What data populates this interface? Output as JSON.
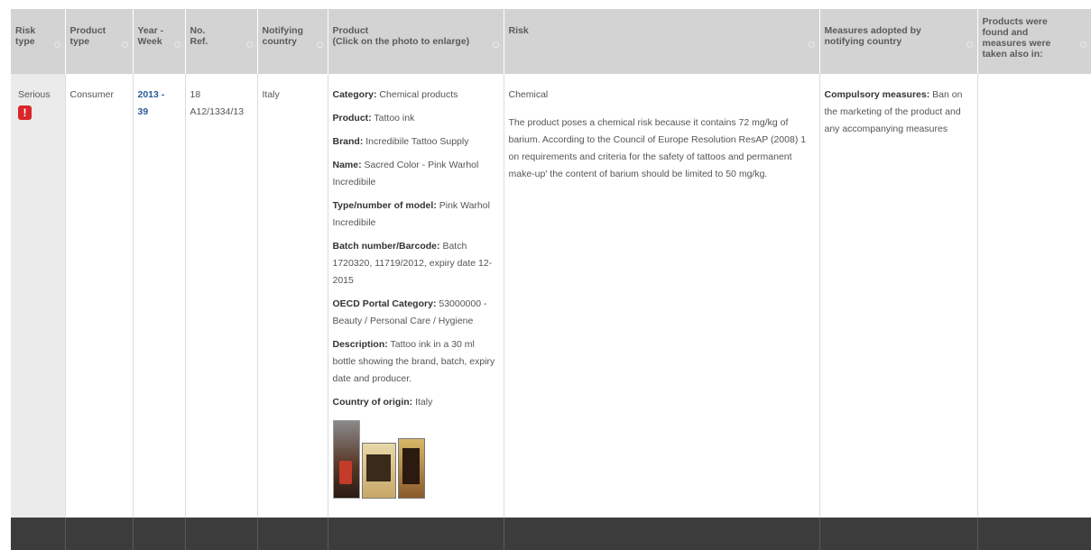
{
  "headers": [
    "Risk\ntype",
    "Product\ntype",
    "Year -\nWeek",
    "No.\nRef.",
    "Notifying\ncountry",
    "Product\n(Click on the photo to enlarge)",
    "Risk",
    "Measures adopted by\nnotifying country",
    "Products were\nfound and\nmeasures were\ntaken also in:"
  ],
  "row": {
    "risk_type": "Serious",
    "risk_icon": "!",
    "product_type": "Consumer",
    "year_week": "2013 -\n39",
    "ref": "18\nA12/1334/13",
    "country": "Italy",
    "product": {
      "category_label": "Category:",
      "category": " Chemical products",
      "product_label": "Product:",
      "product": " Tattoo ink",
      "brand_label": "Brand:",
      "brand": " Incredibile Tattoo Supply",
      "name_label": "Name:",
      "name": " Sacred Color - Pink Warhol Incredibile",
      "type_label": "Type/number of model:",
      "type": " Pink Warhol Incredibile",
      "batch_label": "Batch number/Barcode:",
      "batch": " Batch 1720320, 11719/2012, expiry date 12-2015",
      "oecd_label": "OECD Portal Category:",
      "oecd": " 53000000 - Beauty / Personal Care / Hygiene",
      "desc_label": "Description:",
      "desc": " Tattoo ink in a 30 ml bottle showing the brand, batch, expiry date and producer.",
      "origin_label": "Country of origin:",
      "origin": " Italy"
    },
    "risk": {
      "category": "Chemical",
      "description": "The product poses a chemical risk because it contains 72 mg/kg of barium. According to the Council of Europe Resolution ResAP (2008) 1 on requirements and criteria for the safety of tattoos and permanent make-up' the content of barium should be limited to 50 mg/kg."
    },
    "measures": {
      "label": "Compulsory measures:",
      "text": " Ban on the marketing of the product and any accompanying measures"
    },
    "also_in": ""
  }
}
